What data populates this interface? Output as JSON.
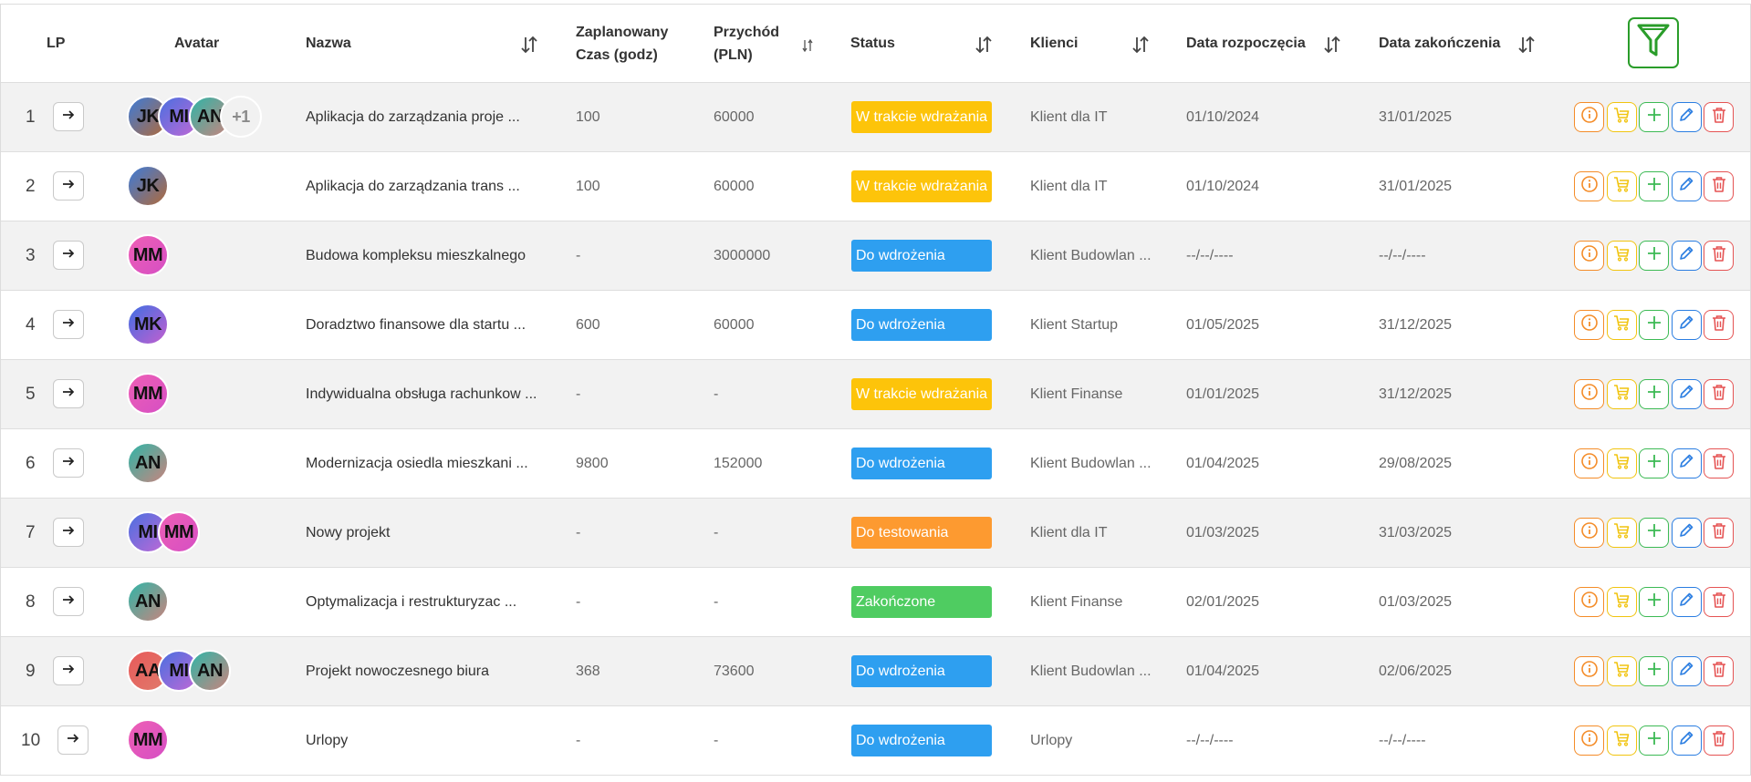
{
  "header": {
    "lp": "LP",
    "avatar": "Avatar",
    "nazwa": "Nazwa",
    "czas_line1": "Zaplanowany",
    "czas_line2": "Czas (godz)",
    "przychod_line1": "Przychód",
    "przychod_line2": "(PLN)",
    "status": "Status",
    "klienci": "Klienci",
    "data_start": "Data rozpoczęcia",
    "data_end": "Data zakończenia"
  },
  "icons": {
    "sort": "sort-arrows-icon",
    "filter": "filter-icon",
    "arrow": "arrow-right-icon",
    "info": "info-icon",
    "cart": "cart-icon",
    "add": "plus-icon",
    "edit": "pencil-icon",
    "delete": "trash-icon"
  },
  "colors": {
    "w_trakcie": "#fdc40a",
    "do_wdrozenia": "#2e9ff0",
    "do_testowania": "#fd9a30",
    "zakonczone": "#4fcc61",
    "info": "#f48c28",
    "cart": "#f1c40f",
    "add": "#3cba54",
    "edit": "#2a7de1",
    "delete": "#e55353",
    "filter": "#2a9d2a"
  },
  "rows": [
    {
      "lp": "1",
      "avatars": [
        "JK",
        "MI",
        "AN"
      ],
      "more": "+1",
      "nazwa": "Aplikacja do zarządzania proje ...",
      "czas": "100",
      "przychod": "60000",
      "status": "W trakcie wdrażania",
      "status_key": "w_trakcie",
      "klient": "Klient dla IT",
      "start": "01/10/2024",
      "end": "31/01/2025"
    },
    {
      "lp": "2",
      "avatars": [
        "JK"
      ],
      "more": "",
      "nazwa": "Aplikacja do zarządzania trans ...",
      "czas": "100",
      "przychod": "60000",
      "status": "W trakcie wdrażania",
      "status_key": "w_trakcie",
      "klient": "Klient dla IT",
      "start": "01/10/2024",
      "end": "31/01/2025"
    },
    {
      "lp": "3",
      "avatars": [
        "MM"
      ],
      "more": "",
      "nazwa": "Budowa kompleksu mieszkalnego",
      "czas": "-",
      "przychod": "3000000",
      "status": "Do wdrożenia",
      "status_key": "do_wdrozenia",
      "klient": "Klient Budowlan ...",
      "start": "--/--/----",
      "end": "--/--/----"
    },
    {
      "lp": "4",
      "avatars": [
        "MK"
      ],
      "more": "",
      "nazwa": "Doradztwo finansowe dla startu ...",
      "czas": "600",
      "przychod": "60000",
      "status": "Do wdrożenia",
      "status_key": "do_wdrozenia",
      "klient": "Klient Startup",
      "start": "01/05/2025",
      "end": "31/12/2025"
    },
    {
      "lp": "5",
      "avatars": [
        "MM"
      ],
      "more": "",
      "nazwa": "Indywidualna obsługa rachunkow ...",
      "czas": "-",
      "przychod": "-",
      "status": "W trakcie wdrażania",
      "status_key": "w_trakcie",
      "klient": "Klient Finanse",
      "start": "01/01/2025",
      "end": "31/12/2025"
    },
    {
      "lp": "6",
      "avatars": [
        "AN"
      ],
      "more": "",
      "nazwa": "Modernizacja osiedla mieszkani ...",
      "czas": "9800",
      "przychod": "152000",
      "status": "Do wdrożenia",
      "status_key": "do_wdrozenia",
      "klient": "Klient Budowlan ...",
      "start": "01/04/2025",
      "end": "29/08/2025"
    },
    {
      "lp": "7",
      "avatars": [
        "MI",
        "MM"
      ],
      "more": "",
      "nazwa": "Nowy projekt",
      "czas": "-",
      "przychod": "-",
      "status": "Do testowania",
      "status_key": "do_testowania",
      "klient": "Klient dla IT",
      "start": "01/03/2025",
      "end": "31/03/2025"
    },
    {
      "lp": "8",
      "avatars": [
        "AN"
      ],
      "more": "",
      "nazwa": "Optymalizacja i restrukturyzac ...",
      "czas": "-",
      "przychod": "-",
      "status": "Zakończone",
      "status_key": "zakonczone",
      "klient": "Klient Finanse",
      "start": "02/01/2025",
      "end": "01/03/2025"
    },
    {
      "lp": "9",
      "avatars": [
        "AA",
        "MI",
        "AN"
      ],
      "more": "",
      "nazwa": "Projekt nowoczesnego biura",
      "czas": "368",
      "przychod": "73600",
      "status": "Do wdrożenia",
      "status_key": "do_wdrozenia",
      "klient": "Klient Budowlan ...",
      "start": "01/04/2025",
      "end": "02/06/2025"
    },
    {
      "lp": "10",
      "avatars": [
        "MM"
      ],
      "more": "",
      "nazwa": "Urlopy",
      "czas": "-",
      "przychod": "-",
      "status": "Do wdrożenia",
      "status_key": "do_wdrozenia",
      "klient": "Urlopy",
      "start": "--/--/----",
      "end": "--/--/----"
    }
  ]
}
